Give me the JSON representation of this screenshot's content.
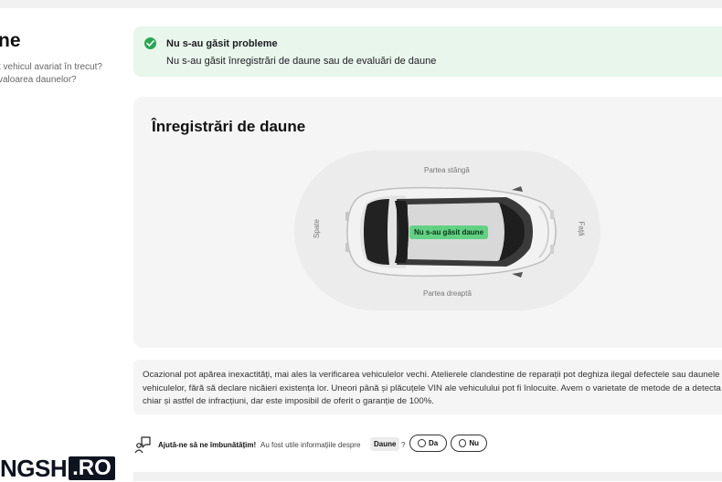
{
  "left": {
    "title": "ne",
    "description": "t vehicul avariat în trecut?\n valoarea daunelor?"
  },
  "alert": {
    "title": "Nu s-au găsit probleme",
    "text": "Nu s-au găsit înregistrări de daune sau de evaluări de daune",
    "color": "#2aa651"
  },
  "damage_card": {
    "title": "Înregistrări de daune",
    "side_left": "Partea stângă",
    "side_right": "Partea dreaptă",
    "back": "Spate",
    "front": "Față",
    "badge": "Nu s-au găsit daune"
  },
  "disclaimer": "Ocazional pot apărea inexactități, mai ales la verificarea vehiculelor vechi. Atelierele clandestine de reparații pot deghiza ilegal defectele sau daunele vehiculelor, fără să declare nicăieri existența lor. Uneori până și plăcuțele VIN ale vehiculului pot fi înlocuite. Avem o varietate de metode de a detecta chiar și astfel de infracțiuni, dar este imposibil de oferit o garanție de 100%.",
  "feedback": {
    "prompt": "Ajută-ne să ne îmbunătățim!",
    "question": "Au fost utile informațiile despre",
    "topic": "Daune",
    "question_mark": "?",
    "yes": "Da",
    "no": "Nu"
  },
  "watermark": {
    "main": "NGSH",
    "tld": ".RO"
  }
}
